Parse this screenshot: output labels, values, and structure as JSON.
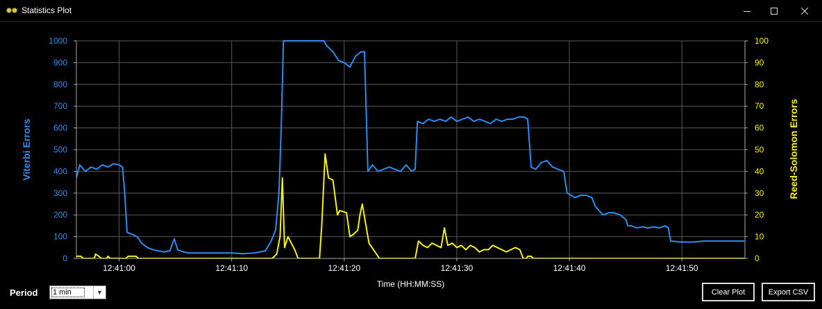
{
  "window": {
    "title": "Statistics Plot",
    "icons": [
      "app-icon",
      "minimize-icon",
      "maximize-icon",
      "close-icon"
    ]
  },
  "controls": {
    "period_label": "Period",
    "period_value": "1 min",
    "clear_label": "Clear Plot",
    "export_label": "Export CSV"
  },
  "chart_data": {
    "type": "line",
    "xlabel": "Time (HH:MM:SS)",
    "ylabel_left": "Viterbi Errors",
    "ylabel_right": "Reed-Solomon Errors",
    "ylim_left": [
      0,
      1000
    ],
    "ylim_right": [
      0,
      100
    ],
    "yticks_left": [
      "0",
      "100",
      "200",
      "300",
      "400",
      "500",
      "600",
      "700",
      "800",
      "900",
      "1000"
    ],
    "yticks_right": [
      "0",
      "10",
      "20",
      "30",
      "40",
      "50",
      "60",
      "70",
      "80",
      "90",
      "100"
    ],
    "xlim": [
      56.2,
      115.6
    ],
    "xticks": [
      {
        "t": 60,
        "label": "12:41:00"
      },
      {
        "t": 70,
        "label": "12:41:10"
      },
      {
        "t": 80,
        "label": "12:41:20"
      },
      {
        "t": 90,
        "label": "12:41:30"
      },
      {
        "t": 100,
        "label": "12:41:40"
      },
      {
        "t": 110,
        "label": "12:41:50"
      }
    ],
    "grid": true,
    "colors": {
      "viterbi": "#2f8cf0",
      "reed_solomon": "#f7f21a",
      "grid": "#5a5a5a",
      "axis": "#aaaaaa"
    },
    "series": [
      {
        "axis": "left",
        "points": [
          [
            56.2,
            370
          ],
          [
            56.5,
            430
          ],
          [
            57,
            400
          ],
          [
            57.5,
            420
          ],
          [
            58,
            410
          ],
          [
            58.5,
            430
          ],
          [
            59,
            420
          ],
          [
            59.5,
            435
          ],
          [
            60,
            430
          ],
          [
            60.3,
            420
          ],
          [
            60.5,
            300
          ],
          [
            60.7,
            120
          ],
          [
            61.2,
            110
          ],
          [
            61.6,
            100
          ],
          [
            62,
            70
          ],
          [
            62.5,
            50
          ],
          [
            63,
            40
          ],
          [
            63.5,
            35
          ],
          [
            64,
            30
          ],
          [
            64.5,
            35
          ],
          [
            64.9,
            90
          ],
          [
            65.2,
            40
          ],
          [
            65.7,
            30
          ],
          [
            66.2,
            25
          ],
          [
            67,
            25
          ],
          [
            68,
            25
          ],
          [
            69,
            25
          ],
          [
            70,
            25
          ],
          [
            71,
            22
          ],
          [
            72,
            25
          ],
          [
            72.5,
            30
          ],
          [
            73,
            35
          ],
          [
            73.5,
            80
          ],
          [
            73.9,
            130
          ],
          [
            74.2,
            300
          ],
          [
            74.4,
            600
          ],
          [
            74.6,
            1000
          ],
          [
            75,
            1000
          ],
          [
            77,
            1000
          ],
          [
            78.2,
            1000
          ],
          [
            78.4,
            980
          ],
          [
            79,
            950
          ],
          [
            79.5,
            910
          ],
          [
            80,
            900
          ],
          [
            80.5,
            880
          ],
          [
            81,
            930
          ],
          [
            81.5,
            950
          ],
          [
            81.8,
            950
          ],
          [
            82.1,
            400
          ],
          [
            82.5,
            430
          ],
          [
            83,
            400
          ],
          [
            83.5,
            410
          ],
          [
            84,
            420
          ],
          [
            84.5,
            410
          ],
          [
            85,
            400
          ],
          [
            85.5,
            430
          ],
          [
            86,
            400
          ],
          [
            86.3,
            410
          ],
          [
            86.5,
            630
          ],
          [
            87,
            620
          ],
          [
            87.5,
            640
          ],
          [
            88,
            630
          ],
          [
            88.5,
            640
          ],
          [
            89,
            630
          ],
          [
            89.5,
            650
          ],
          [
            90,
            630
          ],
          [
            90.5,
            640
          ],
          [
            91,
            650
          ],
          [
            91.5,
            630
          ],
          [
            92,
            640
          ],
          [
            92.5,
            630
          ],
          [
            93,
            620
          ],
          [
            93.5,
            640
          ],
          [
            94,
            630
          ],
          [
            94.5,
            640
          ],
          [
            95,
            640
          ],
          [
            95.5,
            650
          ],
          [
            96,
            650
          ],
          [
            96.3,
            640
          ],
          [
            96.6,
            420
          ],
          [
            97,
            410
          ],
          [
            97.5,
            440
          ],
          [
            98,
            450
          ],
          [
            98.5,
            420
          ],
          [
            99,
            410
          ],
          [
            99.5,
            400
          ],
          [
            99.8,
            300
          ],
          [
            100.5,
            280
          ],
          [
            101,
            290
          ],
          [
            101.5,
            290
          ],
          [
            102,
            280
          ],
          [
            102.3,
            240
          ],
          [
            102.8,
            210
          ],
          [
            103,
            200
          ],
          [
            103.5,
            210
          ],
          [
            104,
            210
          ],
          [
            104.5,
            200
          ],
          [
            105,
            180
          ],
          [
            105.2,
            150
          ],
          [
            105.5,
            150
          ],
          [
            106,
            140
          ],
          [
            106.5,
            145
          ],
          [
            107,
            140
          ],
          [
            107.5,
            145
          ],
          [
            108,
            140
          ],
          [
            108.5,
            150
          ],
          [
            108.8,
            140
          ],
          [
            109,
            80
          ],
          [
            110,
            75
          ],
          [
            111,
            75
          ],
          [
            112,
            80
          ],
          [
            113,
            80
          ],
          [
            114,
            80
          ],
          [
            115,
            80
          ],
          [
            115.6,
            80
          ]
        ]
      },
      {
        "axis": "right",
        "points": [
          [
            56.2,
            1
          ],
          [
            56.6,
            1
          ],
          [
            56.8,
            0
          ],
          [
            57.8,
            0
          ],
          [
            57.9,
            2
          ],
          [
            58.2,
            1
          ],
          [
            58.4,
            0
          ],
          [
            58.9,
            0
          ],
          [
            59,
            1
          ],
          [
            59.2,
            0
          ],
          [
            60.6,
            0
          ],
          [
            60.8,
            1
          ],
          [
            61.5,
            1
          ],
          [
            61.7,
            0
          ],
          [
            73.6,
            0
          ],
          [
            74,
            2
          ],
          [
            74.3,
            10
          ],
          [
            74.5,
            37
          ],
          [
            74.7,
            5
          ],
          [
            75,
            10
          ],
          [
            75.6,
            4
          ],
          [
            75.9,
            0
          ],
          [
            77.8,
            0
          ],
          [
            78,
            15
          ],
          [
            78.3,
            48
          ],
          [
            78.6,
            37
          ],
          [
            79,
            36
          ],
          [
            79.4,
            20
          ],
          [
            79.6,
            22
          ],
          [
            80.2,
            21
          ],
          [
            80.5,
            10
          ],
          [
            80.8,
            11
          ],
          [
            81.2,
            13
          ],
          [
            81.4,
            20
          ],
          [
            81.6,
            25
          ],
          [
            81.9,
            16
          ],
          [
            82.2,
            7
          ],
          [
            82.6,
            4
          ],
          [
            83,
            1
          ],
          [
            83.1,
            0
          ],
          [
            86.3,
            0
          ],
          [
            86.6,
            8
          ],
          [
            87,
            6
          ],
          [
            87.4,
            5
          ],
          [
            87.8,
            7
          ],
          [
            88.2,
            6
          ],
          [
            88.6,
            5
          ],
          [
            88.9,
            14
          ],
          [
            89.2,
            6
          ],
          [
            89.6,
            7
          ],
          [
            90,
            5
          ],
          [
            90.4,
            6
          ],
          [
            90.8,
            4
          ],
          [
            91.2,
            6
          ],
          [
            91.6,
            5
          ],
          [
            92,
            3
          ],
          [
            92.4,
            4
          ],
          [
            92.8,
            4
          ],
          [
            93.2,
            6
          ],
          [
            93.6,
            5
          ],
          [
            94,
            4
          ],
          [
            94.4,
            3
          ],
          [
            94.8,
            4
          ],
          [
            95.2,
            5
          ],
          [
            95.6,
            4
          ],
          [
            95.9,
            0
          ],
          [
            96.2,
            0
          ],
          [
            96.3,
            1
          ],
          [
            96.6,
            1
          ],
          [
            96.8,
            0
          ],
          [
            115.6,
            0
          ]
        ]
      }
    ]
  }
}
